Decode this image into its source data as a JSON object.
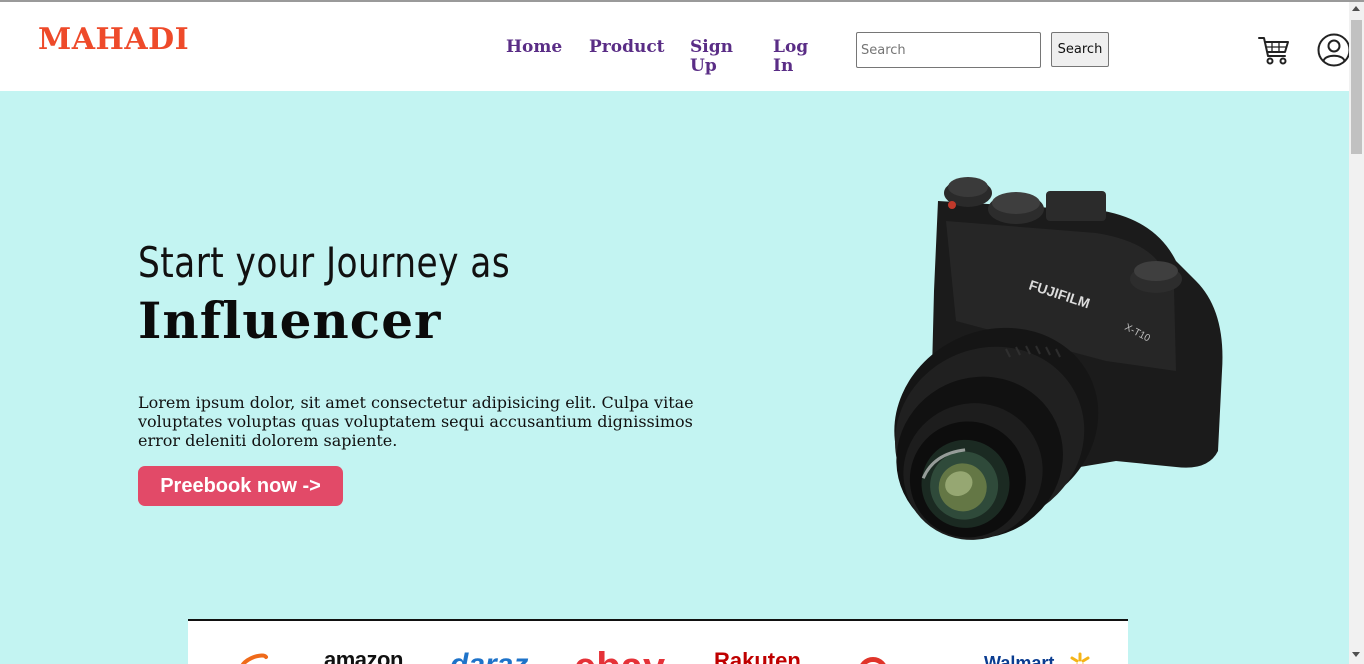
{
  "header": {
    "logo": "MAHADI",
    "nav": {
      "home": "Home",
      "product": "Product",
      "signup": "Sign Up",
      "login": "Log In"
    },
    "search": {
      "placeholder": "Search",
      "button_label": "Search"
    },
    "icons": [
      "cart-icon",
      "user-icon"
    ]
  },
  "hero": {
    "headline_line1": "Start your Journey as",
    "headline_line2": "Influencer",
    "description": "Lorem ipsum dolor, sit amet consectetur adipisicing elit. Culpa vitae voluptates voluptas quas voluptatem sequi accusantium dignissimos error deleniti dolorem sapiente.",
    "cta_label": "Preebook now ->",
    "image": "camera-product-image",
    "camera_brand_text": "FUJIFILM",
    "camera_model_text": "X-T10"
  },
  "brands": {
    "amazon": "amazon",
    "daraz": "daraz",
    "ebay": "ebay",
    "rakuten": "Rakuten",
    "walmart": "Walmart"
  },
  "colors": {
    "logo": "#ee4a2a",
    "nav_link": "#5a2d86",
    "hero_background": "#c3f4f2",
    "cta_background": "#e24a68"
  }
}
